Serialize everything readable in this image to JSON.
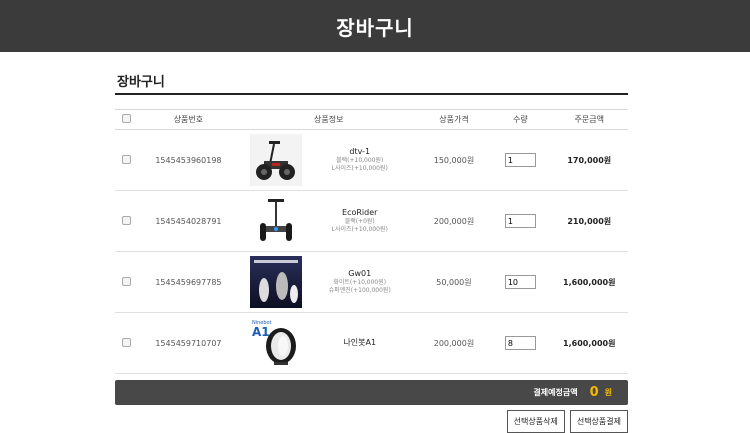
{
  "header": {
    "title": "장바구니"
  },
  "section": {
    "title": "장바구니"
  },
  "table": {
    "columns": [
      "상품번호",
      "상품정보",
      "상품가격",
      "수량",
      "주문금액"
    ],
    "rows": [
      {
        "id": "1545453960198",
        "name": "dtv-1",
        "opt1": "블랙(+10,000원)",
        "opt2": "L사이즈(+10,000원)",
        "price": "150,000원",
        "qty": "1",
        "total": "170,000원",
        "image": "segway-offroad"
      },
      {
        "id": "1545454028791",
        "name": "EcoRider",
        "opt1": "블랙(+0원)",
        "opt2": "L사이즈(+10,000원)",
        "price": "200,000원",
        "qty": "1",
        "total": "210,000원",
        "image": "segway"
      },
      {
        "id": "1545459697785",
        "name": "Gw01",
        "opt1": "화이트(+10,000원)",
        "opt2": "슈퍼엔진(+100,000원)",
        "price": "50,000원",
        "qty": "10",
        "total": "1,600,000원",
        "image": "gw01-box"
      },
      {
        "id": "1545459710707",
        "name": "나인봇A1",
        "opt1": "",
        "opt2": "",
        "price": "200,000원",
        "qty": "8",
        "total": "1,600,000원",
        "image": "ninebot-a1",
        "badge1": "Ninebot",
        "badge2": "A1"
      }
    ]
  },
  "summary": {
    "label": "결제예정금액",
    "value": "0",
    "unit": "원"
  },
  "buttons": {
    "delete": "선택상품삭제",
    "pay": "선택상품결제"
  }
}
